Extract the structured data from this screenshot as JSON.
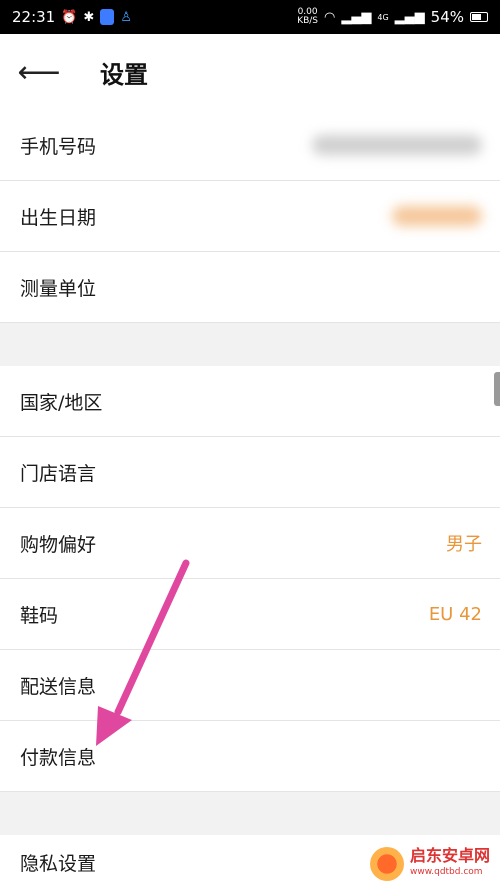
{
  "status_bar": {
    "time": "22:31",
    "net_speed_value": "0.00",
    "net_speed_unit": "KB/S",
    "signal_label_1": "4G",
    "battery": "54%"
  },
  "header": {
    "title": "设置"
  },
  "rows": [
    {
      "label": "手机号码",
      "value": ""
    },
    {
      "label": "出生日期",
      "value": ""
    },
    {
      "label": "测量单位",
      "value": ""
    },
    {
      "label": "国家/地区",
      "value": ""
    },
    {
      "label": "门店语言",
      "value": ""
    },
    {
      "label": "购物偏好",
      "value": "男子"
    },
    {
      "label": "鞋码",
      "value": "EU 42"
    },
    {
      "label": "配送信息",
      "value": ""
    },
    {
      "label": "付款信息",
      "value": ""
    },
    {
      "label": "隐私设置",
      "value": ""
    }
  ],
  "colors": {
    "value_accent": "#e8963a",
    "arrow": "#e0479e",
    "section_gap": "#f2f2f2"
  },
  "watermark": {
    "name": "启东安卓网",
    "url": "www.qdtbd.com"
  }
}
